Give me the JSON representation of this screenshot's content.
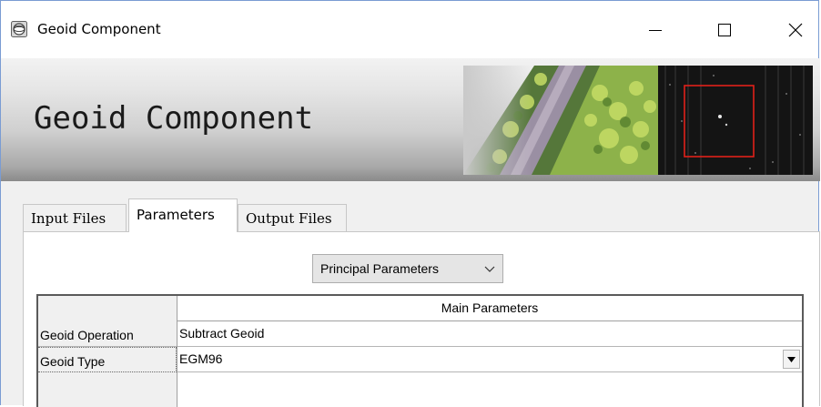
{
  "window": {
    "title": "Geoid Component"
  },
  "banner": {
    "title": "Geoid Component"
  },
  "tabs": [
    {
      "label": "Input Files",
      "active": false
    },
    {
      "label": "Parameters",
      "active": true
    },
    {
      "label": "Output Files",
      "active": false
    }
  ],
  "parameter_section": {
    "selected": "Principal Parameters"
  },
  "table": {
    "column_header": "Main Parameters",
    "rows": [
      {
        "label": "Geoid Operation",
        "value": "Subtract Geoid"
      },
      {
        "label": "Geoid Type",
        "value": "EGM96"
      }
    ]
  },
  "icons": {
    "app": "globe-icon",
    "minimize": "minimize-icon",
    "maximize": "maximize-icon",
    "close": "close-icon",
    "dropdown": "chevron-down-icon",
    "combo": "triangle-down-icon"
  },
  "colors": {
    "window_border": "#7a9cd3",
    "radar_box": "#e0201a"
  }
}
